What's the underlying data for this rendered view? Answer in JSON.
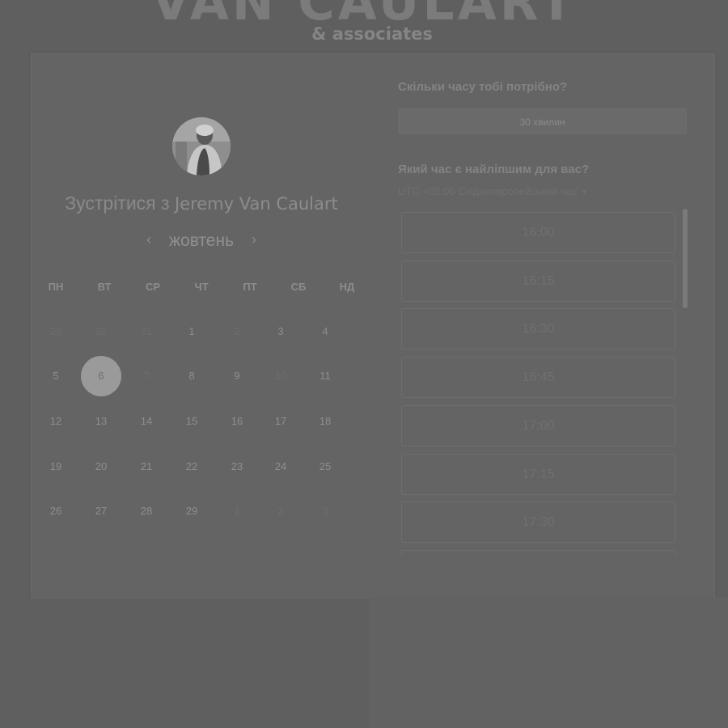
{
  "brand": {
    "title": "VAN CAULART",
    "subtitle": "& associates"
  },
  "meeting": {
    "prefix": "Зустрітися з",
    "host": "Jeremy Van Caulart",
    "avatar_icon": "person-photo-avatar"
  },
  "calendar": {
    "month": "жовтень",
    "prev_icon": "chevron-left-icon",
    "next_icon": "chevron-right-icon",
    "weekdays": [
      "ПН",
      "ВТ",
      "СР",
      "ЧТ",
      "ПТ",
      "СБ",
      "НД"
    ],
    "weeks": [
      [
        {
          "d": "29",
          "s": "muted"
        },
        {
          "d": "30",
          "s": "muted"
        },
        {
          "d": "31",
          "s": "muted"
        },
        {
          "d": "1",
          "s": "available"
        },
        {
          "d": "2",
          "s": "muted"
        },
        {
          "d": "3",
          "s": "available"
        },
        {
          "d": "4",
          "s": "available"
        }
      ],
      [
        {
          "d": "5",
          "s": "available"
        },
        {
          "d": "6",
          "s": "selected"
        },
        {
          "d": "7",
          "s": "muted"
        },
        {
          "d": "8",
          "s": "available"
        },
        {
          "d": "9",
          "s": "available"
        },
        {
          "d": "10",
          "s": "muted"
        },
        {
          "d": "11",
          "s": "available"
        }
      ],
      [
        {
          "d": "12",
          "s": "available"
        },
        {
          "d": "13",
          "s": "available"
        },
        {
          "d": "14",
          "s": "available"
        },
        {
          "d": "15",
          "s": "available"
        },
        {
          "d": "16",
          "s": "available"
        },
        {
          "d": "17",
          "s": "available"
        },
        {
          "d": "18",
          "s": "available"
        }
      ],
      [
        {
          "d": "19",
          "s": "available"
        },
        {
          "d": "20",
          "s": "available"
        },
        {
          "d": "21",
          "s": "available"
        },
        {
          "d": "22",
          "s": "available"
        },
        {
          "d": "23",
          "s": "available"
        },
        {
          "d": "24",
          "s": "available"
        },
        {
          "d": "25",
          "s": "available"
        }
      ],
      [
        {
          "d": "26",
          "s": "available"
        },
        {
          "d": "27",
          "s": "available"
        },
        {
          "d": "28",
          "s": "available"
        },
        {
          "d": "29",
          "s": "available"
        },
        {
          "d": "1",
          "s": "muted"
        },
        {
          "d": "2",
          "s": "muted"
        },
        {
          "d": "3",
          "s": "muted"
        }
      ]
    ]
  },
  "booking": {
    "duration_question": "Скільки часу тобі потрібно?",
    "duration_value": "30 хвилин",
    "time_question": "Який час є найліпшим для вас?",
    "timezone": "UTC +03:00 Східноєвропейський час",
    "timezone_icon": "caret-down-icon",
    "slots": [
      "16:00",
      "16:15",
      "16:30",
      "16:45",
      "17:00",
      "17:15",
      "17:30",
      ""
    ]
  },
  "colors": {
    "overlay_background": "#5f5f5f",
    "card_background": "#646464",
    "selected_day": "#9a9a9a"
  }
}
